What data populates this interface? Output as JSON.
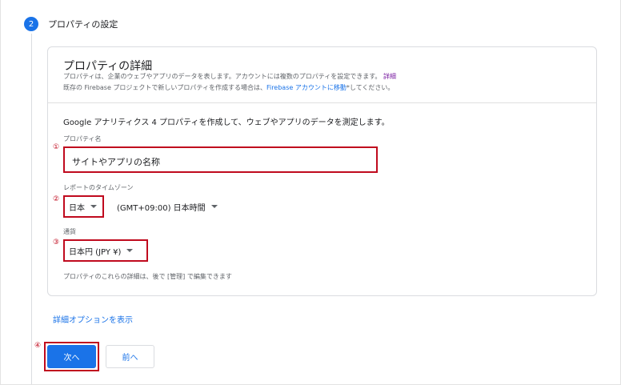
{
  "step": {
    "number": "2",
    "title": "プロパティの設定"
  },
  "card": {
    "title": "プロパティの詳細",
    "desc1_text": "プロパティは、企業のウェブやアプリのデータを表します。アカウントには複数のプロパティを設定できます。",
    "desc1_link": "詳細",
    "desc2_pre": "既存の Firebase プロジェクトで新しいプロパティを作成する場合は、",
    "desc2_link": "Firebase アカウントに移動",
    "desc2_post": "*してください。"
  },
  "intro": "Google アナリティクス 4 プロパティを作成して、ウェブやアプリのデータを測定します。",
  "markers": {
    "m1": "①",
    "m2": "②",
    "m3": "③",
    "m4": "④"
  },
  "property_name": {
    "label": "プロパティ名",
    "value": "サイトやアプリの名称"
  },
  "timezone": {
    "label": "レポートのタイムゾーン",
    "country": "日本",
    "zone": "(GMT+09:00) 日本時間"
  },
  "currency": {
    "label": "通貨",
    "value": "日本円 (JPY ¥)"
  },
  "footnote": "プロパティのこれらの詳細は、後で [管理] で編集できます",
  "advanced_link": "詳細オプションを表示",
  "buttons": {
    "next": "次へ",
    "prev": "前へ"
  },
  "colors": {
    "accent": "#1a73e8",
    "highlight": "#c00a1e"
  }
}
